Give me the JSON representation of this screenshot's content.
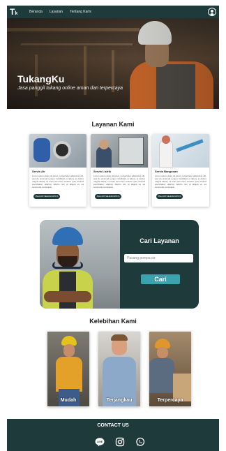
{
  "nav": {
    "logo_main": "T",
    "logo_sub": "k",
    "links": [
      "Beranda",
      "Layanan",
      "Tentang Kami"
    ],
    "profile_icon": "user-circle-icon"
  },
  "hero": {
    "title": "TukangKu",
    "subtitle": "Jasa panggil tukang online aman dan terpercaya"
  },
  "services": {
    "heading": "Layanan Kami",
    "cards": [
      {
        "title": "Servis Air",
        "description": "Lorem ipsum dolor sit amet, consectetur adipiscing elit, sed do eiusmod tempor incididunt ut labore et dolore magna aliqua. Ut enim ad minim veniam, quis nostrud exercitation ullamco laboris nisi ut aliquip ex ea commodo consequat.",
        "button": "PELAJARI SELENGKAPNYA"
      },
      {
        "title": "Servis Listrik",
        "description": "Lorem ipsum dolor sit amet, consectetur adipiscing elit, sed do eiusmod tempor incididunt ut labore et dolore magna aliqua. Ut enim ad minim veniam, quis nostrud exercitation ullamco laboris nisi ut aliquip ex ea commodo consequat.",
        "button": "PELAJARI SELENGKAPNYA"
      },
      {
        "title": "Servis Bangunan",
        "description": "Lorem ipsum dolor sit amet, consectetur adipiscing elit, sed do eiusmod tempor incididunt ut labore et dolore magna aliqua. Ut enim ad minim veniam, quis nostrud exercitation ullamco laboris nisi ut aliquip ex ea commodo consequat.",
        "button": "PELAJARI SELENGKAPNYA"
      }
    ]
  },
  "search": {
    "title": "Cari Layanan",
    "placeholder": "Pasang pompa air",
    "button": "Cari"
  },
  "advantages": {
    "heading": "Kelebihan Kami",
    "items": [
      "Mudah",
      "Terjangkau",
      "Terpercaya"
    ]
  },
  "footer": {
    "title": "CONTACT US",
    "icons": [
      "line-icon",
      "instagram-icon",
      "whatsapp-icon"
    ],
    "line_label": "LINE"
  },
  "colors": {
    "primary": "#1f3a3a",
    "accent": "#3aa3ad"
  }
}
